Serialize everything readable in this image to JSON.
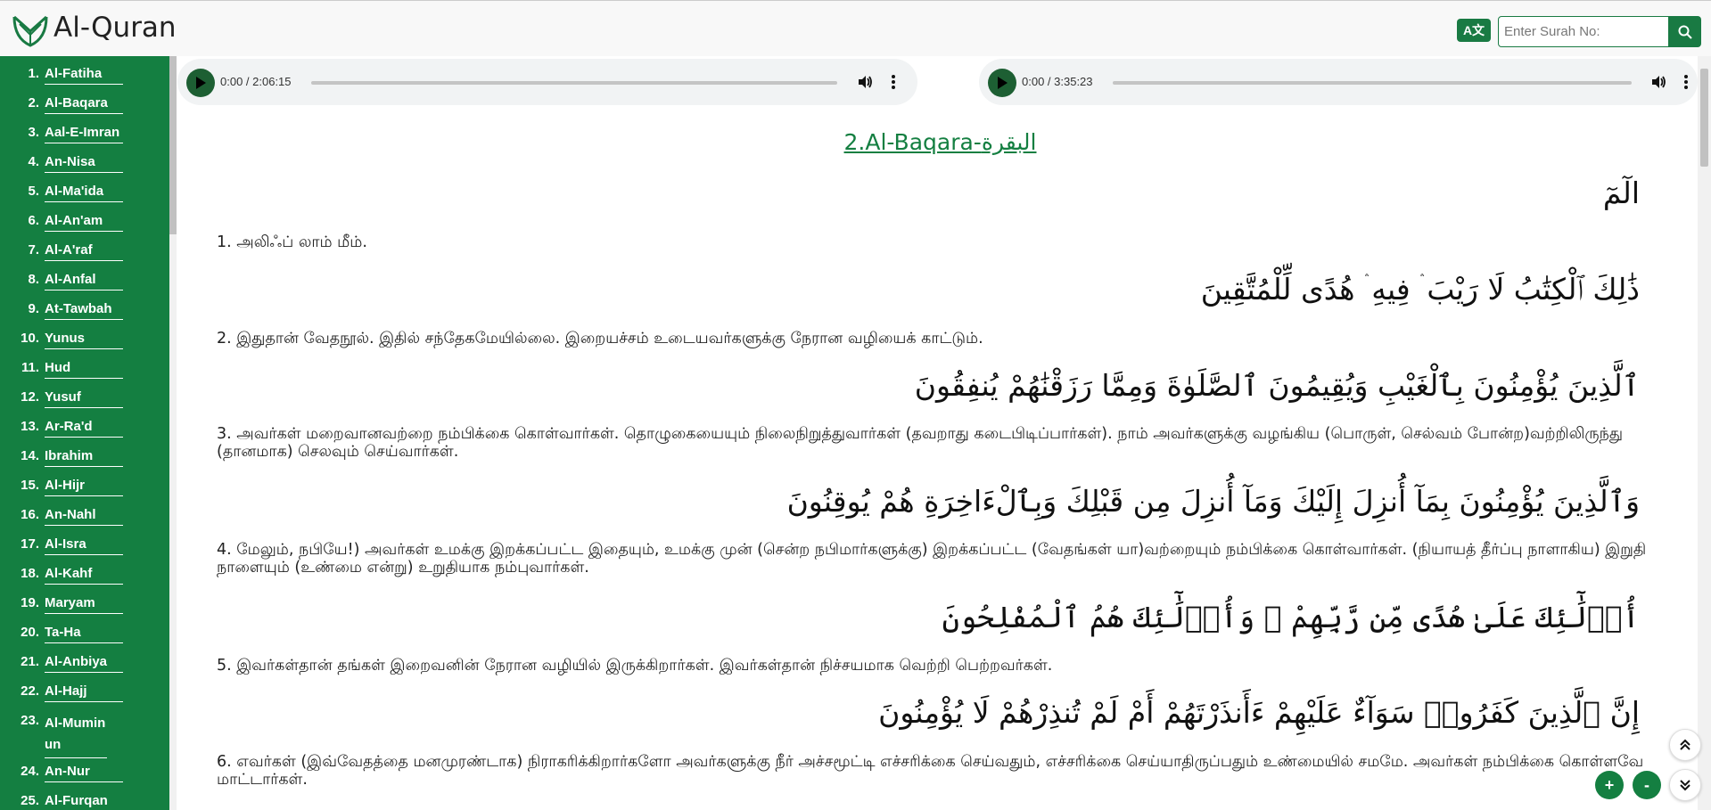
{
  "header": {
    "brand": "Al-Quran",
    "lang_toggle": "A文",
    "search_placeholder": "Enter Surah No:"
  },
  "sidebar": {
    "items": [
      {
        "num": "1.",
        "name": "Al-Fatiha"
      },
      {
        "num": "2.",
        "name": "Al-Baqara"
      },
      {
        "num": "3.",
        "name": "Aal-E-Imran"
      },
      {
        "num": "4.",
        "name": "An-Nisa"
      },
      {
        "num": "5.",
        "name": "Al-Ma'ida"
      },
      {
        "num": "6.",
        "name": "Al-An'am"
      },
      {
        "num": "7.",
        "name": "Al-A'raf"
      },
      {
        "num": "8.",
        "name": "Al-Anfal"
      },
      {
        "num": "9.",
        "name": "At-Tawbah"
      },
      {
        "num": "10.",
        "name": "Yunus"
      },
      {
        "num": "11.",
        "name": "Hud"
      },
      {
        "num": "12.",
        "name": "Yusuf"
      },
      {
        "num": "13.",
        "name": "Ar-Ra'd"
      },
      {
        "num": "14.",
        "name": "Ibrahim"
      },
      {
        "num": "15.",
        "name": "Al-Hijr"
      },
      {
        "num": "16.",
        "name": "An-Nahl"
      },
      {
        "num": "17.",
        "name": "Al-Isra"
      },
      {
        "num": "18.",
        "name": "Al-Kahf"
      },
      {
        "num": "19.",
        "name": "Maryam"
      },
      {
        "num": "20.",
        "name": "Ta-Ha"
      },
      {
        "num": "21.",
        "name": "Al-Anbiya"
      },
      {
        "num": "22.",
        "name": "Al-Hajj"
      },
      {
        "num": "23.",
        "name": "Al-Muminun"
      },
      {
        "num": "24.",
        "name": "An-Nur"
      },
      {
        "num": "25.",
        "name": "Al-Furqan"
      }
    ]
  },
  "players": [
    {
      "time": "0:00 / 2:06:15"
    },
    {
      "time": "0:00 / 3:35:23"
    }
  ],
  "surah_title": "2.Al-Baqara-البقرة",
  "verses": [
    {
      "arabic": "الٓمٓ",
      "tamil": "1. அலிஃப் லாம் மீம்."
    },
    {
      "arabic": "ذَٰلِكَ ٱلْكِتَٰبُ لَا رَيْبَ ۛ فِيهِ ۛ هُدًى لِّلْمُتَّقِينَ",
      "tamil": "2. இதுதான் வேதநூல். இதில் சந்தேகமேயில்லை. இறையச்சம் உடையவர்களுக்கு நேரான வழியைக் காட்டும்."
    },
    {
      "arabic": "ٱلَّذِينَ يُؤْمِنُونَ بِٱلْغَيْبِ وَيُقِيمُونَ ٱلصَّلَوٰةَ وَمِمَّا رَزَقْنَٰهُمْ يُنفِقُونَ",
      "tamil": "3. அவர்கள் மறைவானவற்றை நம்பிக்கை கொள்வார்கள். தொழுகையையும் நிலைநிறுத்துவார்கள் (தவறாது கடைபிடிப்பார்கள்). நாம் அவர்களுக்கு வழங்கிய (பொருள், செல்வம் போன்ற)வற்றிலிருந்து (தானமாக) செலவும் செய்வார்கள்."
    },
    {
      "arabic": "وَٱلَّذِينَ يُؤْمِنُونَ بِمَآ أُنزِلَ إِلَيْكَ وَمَآ أُنزِلَ مِن قَبْلِكَ وَبِٱلْءَاخِرَةِ هُمْ يُوقِنُونَ",
      "tamil": "4. மேலும், நபியே!) அவர்கள் உமக்கு இறக்கப்பட்ட இதையும், உமக்கு முன் (சென்ற நபிமார்களுக்கு) இறக்கப்பட்ட (வேதங்கள் யா)வற்றையும் நம்பிக்கை கொள்வார்கள். (நியாயத் தீர்ப்பு நாளாகிய) இறுதி நாளையும் (உண்மை என்று) உறுதியாக நம்புவார்கள்."
    },
    {
      "arabic": "أُو۟لَٰٓئِكَ عَلَىٰ هُدًى مِّن رَّبِّهِمْ ۖ وَأُو۟لَٰٓئِكَ هُمُ ٱلْمُفْلِحُونَ",
      "tamil": "5. இவர்கள்தான் தங்கள் இறைவனின் நேரான வழியில் இருக்கிறார்கள். இவர்கள்தான் நிச்சயமாக வெற்றி பெற்றவர்கள்."
    },
    {
      "arabic": "إِنَّ ٱلَّذِينَ كَفَرُوا۟ سَوَآءٌ عَلَيْهِمْ ءَأَنذَرْتَهُمْ أَمْ لَمْ تُنذِرْهُمْ لَا يُؤْمِنُونَ",
      "tamil": "6. எவர்கள் (இவ்வேதத்தை மனமுரண்டாக) நிராகரிக்கிறார்களோ அவர்களுக்கு நீர் அச்சமூட்டி எச்சரிக்கை செய்வதும், எச்சரிக்கை செய்யாதிருப்பதும் உண்மையில் சமமே. அவர்கள் நம்பிக்கை கொள்ளவே மாட்டார்கள்."
    }
  ],
  "controls": {
    "zoom_in": "+",
    "zoom_out": "-"
  },
  "colors": {
    "brand_green": "#147f41"
  }
}
